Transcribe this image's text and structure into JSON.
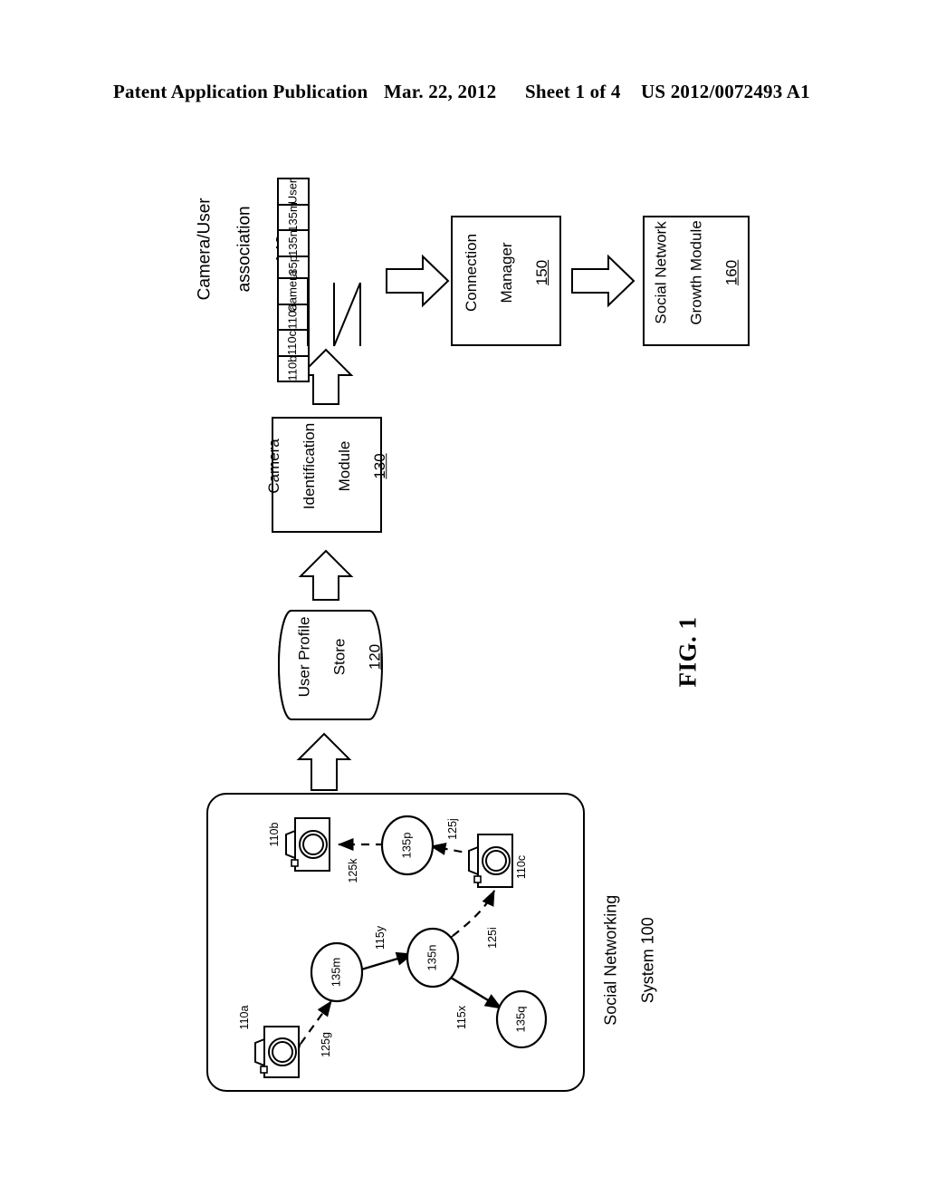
{
  "header": {
    "title": "Patent Application Publication",
    "date": "Mar. 22, 2012",
    "sheet": "Sheet 1 of 4",
    "publication_number": "US 2012/0072493 A1"
  },
  "figure": {
    "label": "FIG. 1"
  },
  "association": {
    "title_line1": "Camera/User",
    "title_line2": "association",
    "ref": "140",
    "user_row": {
      "header": "User",
      "cells": [
        "135m",
        "135n",
        "135p"
      ]
    },
    "camera_row": {
      "header": "Camera",
      "cells": [
        "110a",
        "110c",
        "110b"
      ]
    }
  },
  "modules": {
    "user_profile_store": {
      "line1": "User Profile",
      "line2": "Store",
      "ref": "120"
    },
    "camera_identification_module": {
      "line1": "Camera",
      "line2": "Identification",
      "line3": "Module",
      "ref": "130"
    },
    "connection_manager": {
      "line1": "Connection",
      "line2": "Manager",
      "ref": "150"
    },
    "social_network_growth_module": {
      "line1": "Social Network",
      "line2": "Growth Module",
      "ref": "160"
    }
  },
  "social_networking_system": {
    "label_line1": "Social Networking",
    "label_line2": "System 100",
    "cameras": [
      {
        "id": "camera-110a",
        "ref": "110a"
      },
      {
        "id": "camera-110b",
        "ref": "110b"
      },
      {
        "id": "camera-110c",
        "ref": "110c"
      }
    ],
    "users": [
      {
        "id": "user-135m",
        "ref": "135m"
      },
      {
        "id": "user-135n",
        "ref": "135n"
      },
      {
        "id": "user-135p",
        "ref": "135p"
      },
      {
        "id": "user-135q",
        "ref": "135q"
      }
    ],
    "edges": [
      {
        "id": "edge-125g",
        "ref": "125g",
        "style": "dashed",
        "from": "camera-110a",
        "to": "user-135m"
      },
      {
        "id": "edge-125i",
        "ref": "125i",
        "style": "dashed",
        "from": "user-135n",
        "to": "camera-110c"
      },
      {
        "id": "edge-125j",
        "ref": "125j",
        "style": "dashed",
        "from": "camera-110c",
        "to": "user-135p"
      },
      {
        "id": "edge-125k",
        "ref": "125k",
        "style": "dashed",
        "from": "user-135p",
        "to": "camera-110b"
      },
      {
        "id": "edge-115x",
        "ref": "115x",
        "style": "solid",
        "from": "user-135n",
        "to": "user-135q"
      },
      {
        "id": "edge-115y",
        "ref": "115y",
        "style": "solid",
        "from": "user-135m",
        "to": "user-135n"
      }
    ]
  },
  "colors": {
    "ink": "#000000",
    "paper": "#ffffff"
  }
}
